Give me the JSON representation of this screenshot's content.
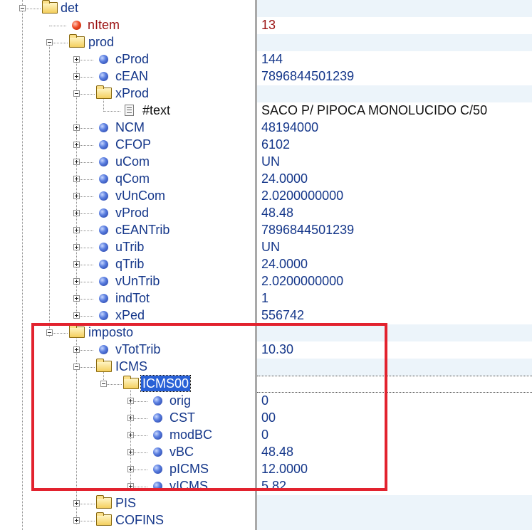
{
  "nodes": [
    {
      "label": "det"
    },
    {
      "label": "nItem"
    },
    {
      "label": "prod"
    },
    {
      "label": "cProd"
    },
    {
      "label": "cEAN"
    },
    {
      "label": "xProd"
    },
    {
      "label": "#text"
    },
    {
      "label": "NCM"
    },
    {
      "label": "CFOP"
    },
    {
      "label": "uCom"
    },
    {
      "label": "qCom"
    },
    {
      "label": "vUnCom"
    },
    {
      "label": "vProd"
    },
    {
      "label": "cEANTrib"
    },
    {
      "label": "uTrib"
    },
    {
      "label": "qTrib"
    },
    {
      "label": "vUnTrib"
    },
    {
      "label": "indTot"
    },
    {
      "label": "xPed"
    },
    {
      "label": "imposto"
    },
    {
      "label": "vTotTrib"
    },
    {
      "label": "ICMS"
    },
    {
      "label": "ICMS00"
    },
    {
      "label": "orig"
    },
    {
      "label": "CST"
    },
    {
      "label": "modBC"
    },
    {
      "label": "vBC"
    },
    {
      "label": "pICMS"
    },
    {
      "label": "vICMS"
    },
    {
      "label": "PIS"
    },
    {
      "label": "COFINS"
    }
  ],
  "values": {
    "nItem": "13",
    "cProd": "144",
    "cEAN": "7896844501239",
    "text": "SACO P/ PIPOCA MONOLUCIDO C/50",
    "NCM": "48194000",
    "CFOP": "6102",
    "uCom": "UN",
    "qCom": "24.0000",
    "vUnCom": "2.0200000000",
    "vProd": "48.48",
    "cEANTrib": "7896844501239",
    "uTrib": "UN",
    "qTrib": "24.0000",
    "vUnTrib": "2.0200000000",
    "indTot": "1",
    "xPed": "556742",
    "vTotTrib": "10.30",
    "orig": "0",
    "CST": "00",
    "modBC": "0",
    "vBC": "48.48",
    "pICMS": "12.0000",
    "vICMS": "5.82"
  },
  "colors": {
    "node_text": "#15378a",
    "accent_red": "#9b1212",
    "selection": "#2860d6",
    "highlight_box": "#e2222e",
    "row_band": "#ecf4fa"
  }
}
